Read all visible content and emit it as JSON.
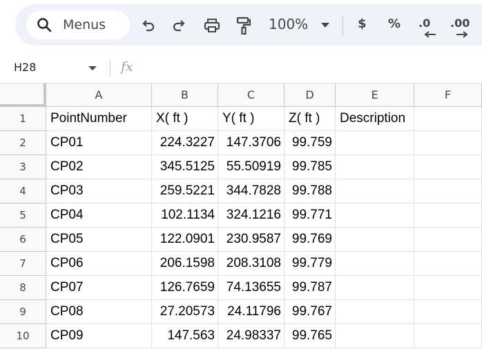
{
  "toolbar": {
    "menus_label": "Menus",
    "zoom": "100%",
    "currency_label": "$",
    "percent_label": "%",
    "decrease_decimal_label": ".0",
    "increase_decimal_label": ".00"
  },
  "formula_bar": {
    "name_box": "H28",
    "fx_label": "fx",
    "formula": ""
  },
  "columns": [
    "A",
    "B",
    "C",
    "D",
    "E",
    "F"
  ],
  "rows": [
    {
      "n": "1",
      "cells": [
        "PointNumber",
        "X( ft )",
        "Y( ft )",
        "Z( ft )",
        "Description",
        ""
      ]
    },
    {
      "n": "2",
      "cells": [
        "CP01",
        "224.3227",
        "147.3706",
        "99.759",
        "",
        ""
      ]
    },
    {
      "n": "3",
      "cells": [
        "CP02",
        "345.5125",
        "55.50919",
        "99.785",
        "",
        ""
      ]
    },
    {
      "n": "4",
      "cells": [
        "CP03",
        "259.5221",
        "344.7828",
        "99.788",
        "",
        ""
      ]
    },
    {
      "n": "5",
      "cells": [
        "CP04",
        "102.1134",
        "324.1216",
        "99.771",
        "",
        ""
      ]
    },
    {
      "n": "6",
      "cells": [
        "CP05",
        "122.0901",
        "230.9587",
        "99.769",
        "",
        ""
      ]
    },
    {
      "n": "7",
      "cells": [
        "CP06",
        "206.1598",
        "208.3108",
        "99.779",
        "",
        ""
      ]
    },
    {
      "n": "8",
      "cells": [
        "CP07",
        "126.7659",
        "74.13655",
        "99.787",
        "",
        ""
      ]
    },
    {
      "n": "9",
      "cells": [
        "CP08",
        "27.20573",
        "24.11796",
        "99.767",
        "",
        ""
      ]
    },
    {
      "n": "10",
      "cells": [
        "CP09",
        "147.563",
        "24.98337",
        "99.765",
        "",
        ""
      ]
    }
  ]
}
